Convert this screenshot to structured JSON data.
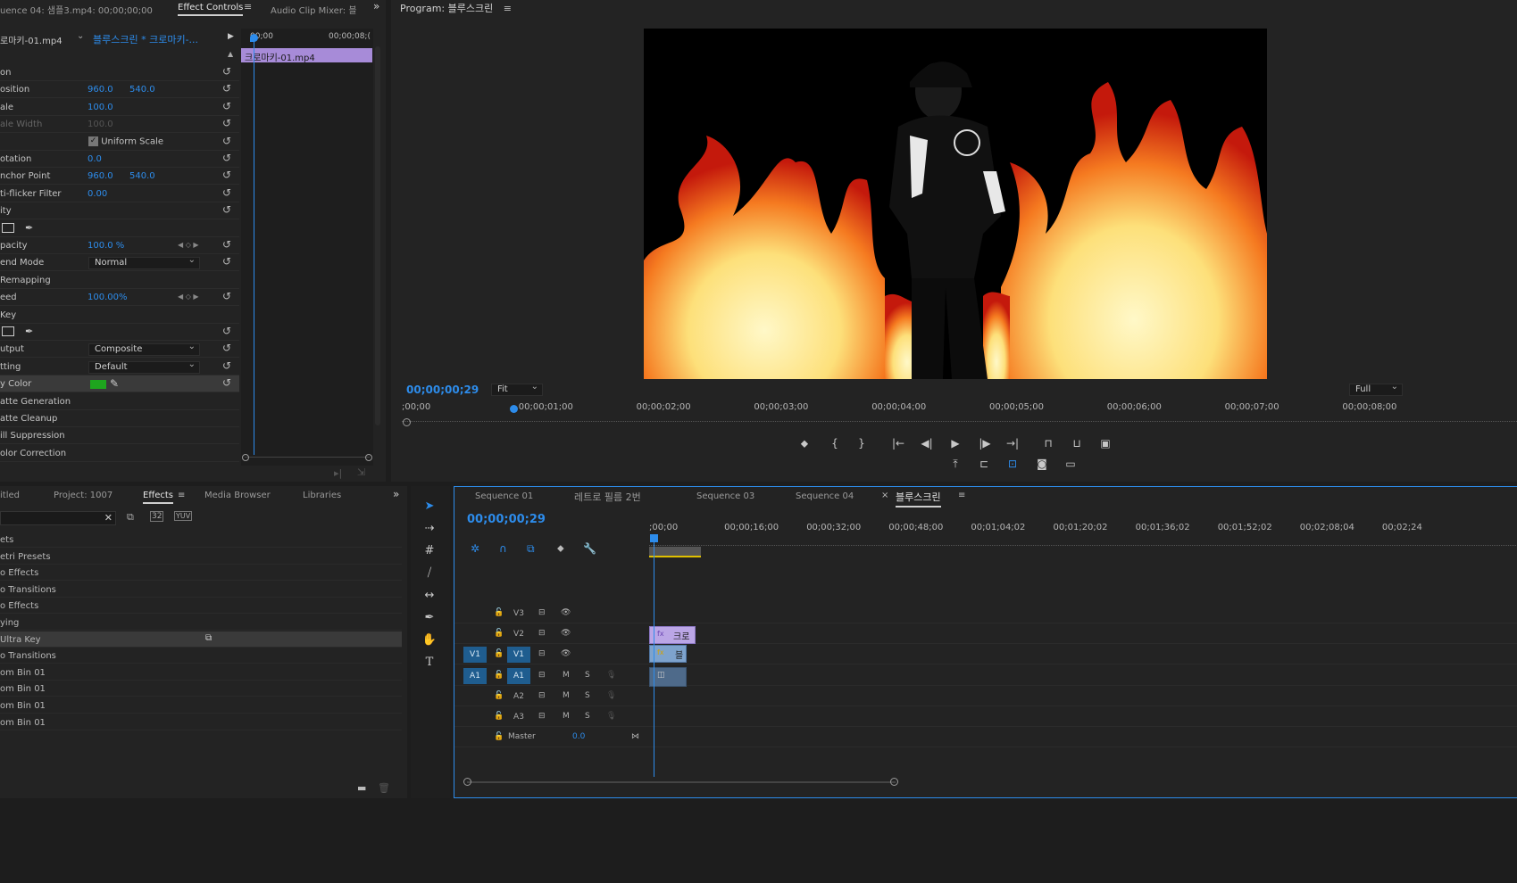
{
  "effect_controls": {
    "tabs": [
      "uence 04: 샘플3.mp4: 00;00;00;00",
      "Effect Controls",
      "Audio Clip Mixer: 블"
    ],
    "clip_selector": "로마키-01.mp4",
    "clip_path": "블루스크린 * 크로마키-...",
    "timecode_start": "00;00",
    "timecode_end": "00;00;08;(",
    "timeline_clip": "크로마키-01.mp4",
    "rows": [
      {
        "label": "on",
        "v1": "",
        "v2": ""
      },
      {
        "label": "osition",
        "v1": "960.0",
        "v2": "540.0"
      },
      {
        "label": "ale",
        "v1": "100.0",
        "v2": ""
      },
      {
        "label": "ale Width",
        "v1": "100.0",
        "v2": ""
      },
      {
        "label": "",
        "v1": "",
        "v2": ""
      },
      {
        "label": "otation",
        "v1": "0.0",
        "v2": ""
      },
      {
        "label": "nchor Point",
        "v1": "960.0",
        "v2": "540.0"
      },
      {
        "label": "ti-flicker Filter",
        "v1": "0.00",
        "v2": ""
      },
      {
        "label": "ity",
        "v1": "",
        "v2": ""
      },
      {
        "label": "",
        "v1": "",
        "v2": ""
      },
      {
        "label": "pacity",
        "v1": "100.0 %",
        "v2": ""
      },
      {
        "label": "end Mode",
        "v1": "",
        "v2": ""
      },
      {
        "label": "Remapping",
        "v1": "",
        "v2": ""
      },
      {
        "label": "eed",
        "v1": "100.00%",
        "v2": ""
      },
      {
        "label": "Key",
        "v1": "",
        "v2": ""
      },
      {
        "label": "",
        "v1": "",
        "v2": ""
      },
      {
        "label": "utput",
        "v1": "",
        "v2": ""
      },
      {
        "label": "tting",
        "v1": "",
        "v2": ""
      },
      {
        "label": "y Color",
        "v1": "",
        "v2": ""
      },
      {
        "label": "atte Generation",
        "v1": "",
        "v2": ""
      },
      {
        "label": "atte Cleanup",
        "v1": "",
        "v2": ""
      },
      {
        "label": "ill Suppression",
        "v1": "",
        "v2": ""
      },
      {
        "label": "olor Correction",
        "v1": "",
        "v2": ""
      }
    ],
    "uniform_scale_label": "Uniform Scale",
    "blend_mode": "Normal",
    "output": "Composite",
    "setting": "Default",
    "key_color": "#1ea51e"
  },
  "program": {
    "title": "Program: 블루스크린",
    "timecode": "00;00;00;29",
    "fit": "Fit",
    "quality": "Full",
    "ruler_labels": [
      ";00;00",
      "00;00;01;00",
      "00;00;02;00",
      "00;00;03;00",
      "00;00;04;00",
      "00;00;05;00",
      "00;00;06;00",
      "00;00;07;00",
      "00;00;08;00"
    ]
  },
  "project": {
    "tabs": [
      "itled",
      "Project: 1007",
      "Effects",
      "Media Browser",
      "Libraries"
    ],
    "items": [
      "ets",
      "etri Presets",
      "o Effects",
      "o Transitions",
      "o Effects",
      "ying",
      "Ultra Key",
      "o Transitions",
      "om Bin 01",
      "om Bin 01",
      "om Bin 01",
      "om Bin 01"
    ]
  },
  "timeline": {
    "tabs": [
      "Sequence 01",
      "레트로 필름 2번",
      "Sequence 03",
      "Sequence 04",
      "블루스크린"
    ],
    "timecode": "00;00;00;29",
    "ruler_labels": [
      ";00;00",
      "00;00;16;00",
      "00;00;32;00",
      "00;00;48;00",
      "00;01;04;02",
      "00;01;20;02",
      "00;01;36;02",
      "00;01;52;02",
      "00;02;08;04",
      "00;02;24"
    ],
    "tracks": [
      {
        "name": "V3",
        "src": "",
        "type": "video"
      },
      {
        "name": "V2",
        "src": "",
        "type": "video"
      },
      {
        "name": "V1",
        "src": "V1",
        "type": "video"
      },
      {
        "name": "A1",
        "src": "A1",
        "type": "audio"
      },
      {
        "name": "A2",
        "src": "",
        "type": "audio"
      },
      {
        "name": "A3",
        "src": "",
        "type": "audio"
      }
    ],
    "master_label": "Master",
    "master_value": "0.0",
    "clip_v2": "크로",
    "clip_v1": "블",
    "m": "M",
    "s": "S"
  },
  "colors": {
    "accent": "#2d8ceb",
    "clip_purple": "#a78bd8",
    "clip_blue": "#6b8fb8"
  }
}
